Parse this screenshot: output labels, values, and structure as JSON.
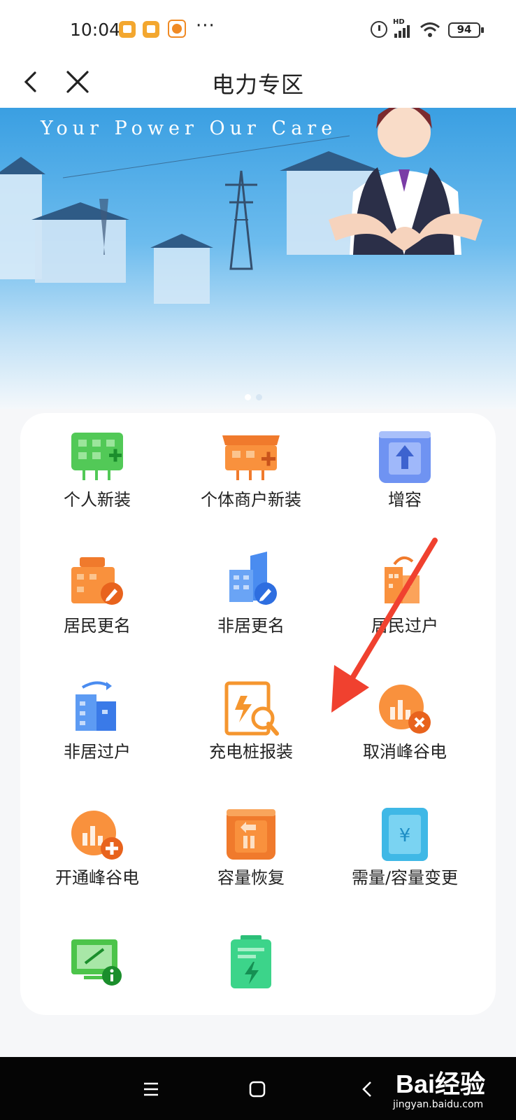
{
  "status_bar": {
    "time": "10:04",
    "more": "···",
    "hd": "HD",
    "battery": "94"
  },
  "nav": {
    "title": "电力专区"
  },
  "banner": {
    "slogan": "Your Power Our Care"
  },
  "services": [
    {
      "label": "个人新装",
      "icon": "new-personal-icon"
    },
    {
      "label": "个体商户新装",
      "icon": "new-merchant-icon"
    },
    {
      "label": "增容",
      "icon": "capacity-increase-icon"
    },
    {
      "label": "居民更名",
      "icon": "resident-rename-icon"
    },
    {
      "label": "非居更名",
      "icon": "nonresident-rename-icon"
    },
    {
      "label": "居民过户",
      "icon": "resident-transfer-icon"
    },
    {
      "label": "非居过户",
      "icon": "nonresident-transfer-icon"
    },
    {
      "label": "充电桩报装",
      "icon": "charging-pile-icon"
    },
    {
      "label": "取消峰谷电",
      "icon": "cancel-peak-valley-icon"
    },
    {
      "label": "开通峰谷电",
      "icon": "open-peak-valley-icon"
    },
    {
      "label": "容量恢复",
      "icon": "capacity-restore-icon"
    },
    {
      "label": "需量/容量变更",
      "icon": "demand-change-icon"
    },
    {
      "label": "",
      "icon": "power-cut-info-icon"
    },
    {
      "label": "",
      "icon": "battery-doc-icon"
    }
  ],
  "watermark": {
    "logo": "Bai经验",
    "url": "jingyan.baidu.com"
  },
  "colors": {
    "green": "#4cc44a",
    "orange": "#f58a2b",
    "blue": "#5c8ef0",
    "red_arrow": "#f0412f"
  }
}
